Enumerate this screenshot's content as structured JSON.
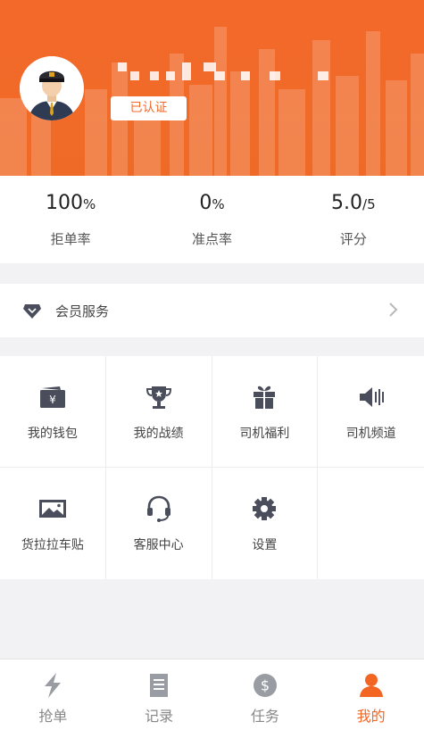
{
  "colors": {
    "brand": "#f2692a",
    "active": "#f26522",
    "icon": "#4a4d5c"
  },
  "profile": {
    "badge": "已认证",
    "avatar_icon": "driver-avatar-icon"
  },
  "stats": [
    {
      "value": "100",
      "unit": "%",
      "label": "拒单率"
    },
    {
      "value": "0",
      "unit": "%",
      "label": "准点率"
    },
    {
      "value": "5.0",
      "unit": "/5",
      "label": "评分"
    }
  ],
  "member": {
    "label": "会员服务",
    "icon": "diamond-icon"
  },
  "grid": [
    {
      "label": "我的钱包",
      "icon": "wallet-icon"
    },
    {
      "label": "我的战绩",
      "icon": "trophy-icon"
    },
    {
      "label": "司机福利",
      "icon": "gift-icon"
    },
    {
      "label": "司机频道",
      "icon": "speaker-icon"
    },
    {
      "label": "货拉拉车贴",
      "icon": "picture-icon"
    },
    {
      "label": "客服中心",
      "icon": "headset-icon"
    },
    {
      "label": "设置",
      "icon": "gear-icon"
    }
  ],
  "nav": [
    {
      "label": "抢单",
      "icon": "lightning-icon",
      "active": false
    },
    {
      "label": "记录",
      "icon": "document-icon",
      "active": false
    },
    {
      "label": "任务",
      "icon": "dollar-icon",
      "active": false
    },
    {
      "label": "我的",
      "icon": "person-icon",
      "active": true
    }
  ]
}
